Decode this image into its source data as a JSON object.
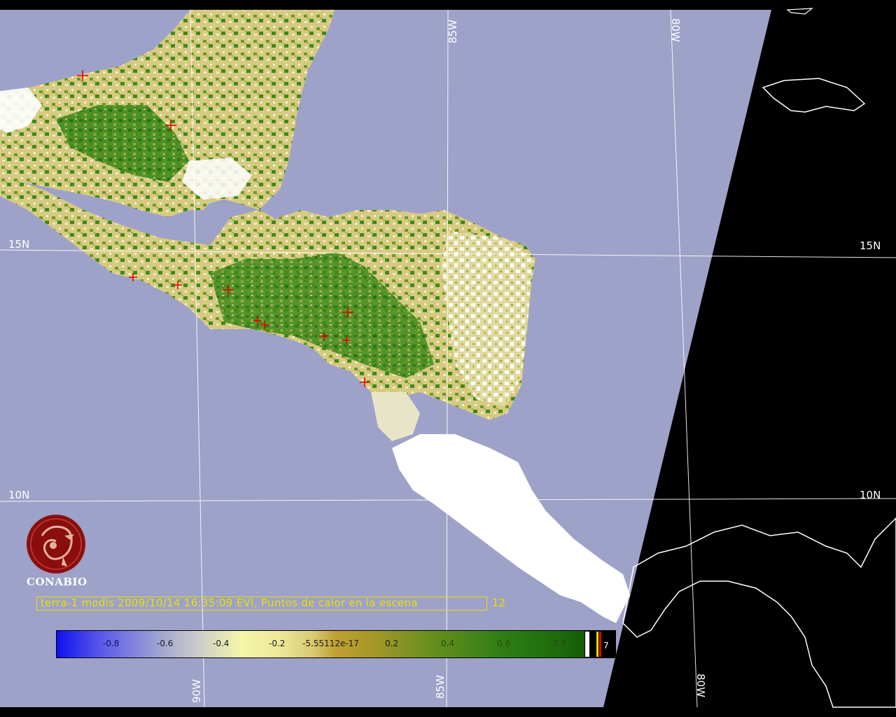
{
  "map": {
    "lon_labels_top": [
      "85W",
      "80W"
    ],
    "lon_labels_bottom": [
      "90W",
      "85W",
      "80W"
    ],
    "lat_labels_left": [
      "15N",
      "10N"
    ],
    "lat_labels_right": [
      "15N",
      "10N"
    ],
    "colors": {
      "background": "#000000",
      "ocean": "#9ea2c8",
      "land_vegetation_low": "#d8cc78",
      "land_vegetation_high": "#2e7e14",
      "cloud": "#ffffff",
      "graticule": "#ffffff",
      "hotspot": "#e00000"
    }
  },
  "logo": {
    "name": "CONABIO"
  },
  "caption": {
    "text": "terra-1 modis 2009/10/14 16:35:09 EVI, Puntos de calor en la escena",
    "count": "12"
  },
  "colorbar": {
    "ticks": [
      "-0.8",
      "-0.6",
      "-0.4",
      "-0.2",
      "-5.55112e-17",
      "0.2",
      "0.4",
      "0.6",
      "0.8"
    ],
    "extra_label": "7"
  }
}
